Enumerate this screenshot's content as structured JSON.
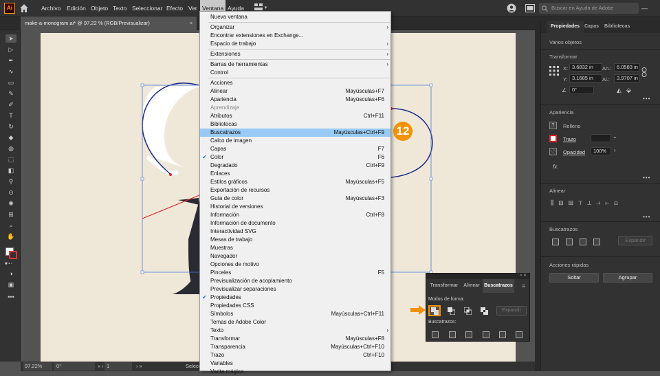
{
  "menubar": {
    "logo": "Ai",
    "items": [
      "Archivo",
      "Edición",
      "Objeto",
      "Texto",
      "Seleccionar",
      "Efecto",
      "Ver",
      "Ventana",
      "Ayuda"
    ],
    "active": "Ventana",
    "search_placeholder": "Buscar en Ayuda de Adobe"
  },
  "document": {
    "tab": "make-a-monogram.ai* @ 97.22 % (RGB/Previsualizar)",
    "close": "×"
  },
  "status": {
    "zoom": "97.22%",
    "rotation": "0°",
    "artboard": "1",
    "select_label": "Selecc"
  },
  "ventana_menu": [
    {
      "label": "Nueva ventana"
    },
    {
      "sep": true
    },
    {
      "label": "Organizar",
      "submenu": true
    },
    {
      "label": "Encontrar extensiones en Exchange..."
    },
    {
      "label": "Espacio de trabajo",
      "submenu": true
    },
    {
      "sep": true
    },
    {
      "label": "Extensiones",
      "submenu": true
    },
    {
      "sep": true
    },
    {
      "label": "Barras de herramientas",
      "submenu": true
    },
    {
      "label": "Control"
    },
    {
      "sep": true
    },
    {
      "label": "Acciones"
    },
    {
      "label": "Alinear",
      "shortcut": "Mayúsculas+F7"
    },
    {
      "label": "Apariencia",
      "shortcut": "Mayúsculas+F6"
    },
    {
      "label": "Aprendizaje",
      "disabled": true
    },
    {
      "label": "Atributos",
      "shortcut": "Ctrl+F11"
    },
    {
      "label": "Bibliotecas"
    },
    {
      "label": "Buscatrazos",
      "shortcut": "Mayúsculas+Ctrl+F9",
      "highlight": true
    },
    {
      "label": "Calco de imagen"
    },
    {
      "label": "Capas",
      "shortcut": "F7"
    },
    {
      "label": "Color",
      "shortcut": "F6",
      "checked": true
    },
    {
      "label": "Degradado",
      "shortcut": "Ctrl+F9"
    },
    {
      "label": "Enlaces"
    },
    {
      "label": "Estilos gráficos",
      "shortcut": "Mayúsculas+F5"
    },
    {
      "label": "Exportación de recursos"
    },
    {
      "label": "Guía de color",
      "shortcut": "Mayúsculas+F3"
    },
    {
      "label": "Historial de versiones"
    },
    {
      "label": "Información",
      "shortcut": "Ctrl+F8"
    },
    {
      "label": "Información de documento"
    },
    {
      "label": "Interactividad SVG"
    },
    {
      "label": "Mesas de trabajo"
    },
    {
      "label": "Muestras"
    },
    {
      "label": "Navegador"
    },
    {
      "label": "Opciones de motivo"
    },
    {
      "label": "Pinceles",
      "shortcut": "F5"
    },
    {
      "label": "Previsualización de acoplamiento"
    },
    {
      "label": "Previsualizar separaciones"
    },
    {
      "label": "Propiedades",
      "checked": true
    },
    {
      "label": "Propiedades CSS"
    },
    {
      "label": "Símbolos",
      "shortcut": "Mayúsculas+Ctrl+F11"
    },
    {
      "label": "Temas de Adobe Color"
    },
    {
      "label": "Texto",
      "submenu": true
    },
    {
      "label": "Transformar",
      "shortcut": "Mayúsculas+F8"
    },
    {
      "label": "Transparencia",
      "shortcut": "Mayúsculas+Ctrl+F10"
    },
    {
      "label": "Trazo",
      "shortcut": "Ctrl+F10"
    },
    {
      "label": "Variables"
    },
    {
      "label": "Varita mágica"
    }
  ],
  "callout": {
    "number": "12",
    "color": "#f39200"
  },
  "properties_panel": {
    "tabs": [
      "Propiedades",
      "Capas",
      "Bibliotecas"
    ],
    "selection": "Varios objetos",
    "transform": {
      "title": "Transformar",
      "x_label": "X:",
      "x": "3.6832 in",
      "w_label": "An.:",
      "w": "6.0583 in",
      "y_label": "Y:",
      "y": "3.1685 in",
      "h_label": "Al.:",
      "h": "3.9707 in",
      "angle": "0°"
    },
    "appearance": {
      "title": "Apariencia",
      "fill": "Relleno",
      "stroke": "Trazo",
      "opacity_label": "Opacidad",
      "opacity": "100%",
      "fx": "fx."
    },
    "align": {
      "title": "Alinear"
    },
    "pathfinder": {
      "title": "Buscatrazos",
      "expand": "Expandir"
    },
    "quick_actions": {
      "title": "Acciones rápidas",
      "release": "Soltar",
      "group": "Agrupar"
    },
    "more": "•••"
  },
  "buscatrazos_panel": {
    "tabs": [
      "Transformar",
      "Alinear",
      "Buscatrazos"
    ],
    "shape_modes": "Modos de forma:",
    "expand": "Expandir",
    "pathfinders": "Buscatrazos:"
  }
}
